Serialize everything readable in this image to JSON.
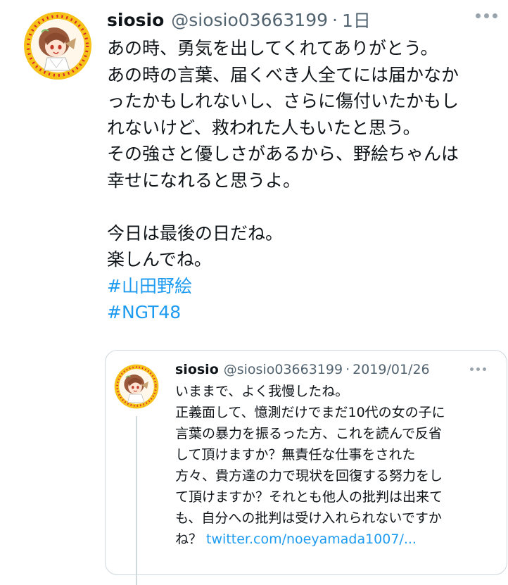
{
  "tweet": {
    "display_name": "siosio",
    "handle": "@siosio03663199",
    "separator": "·",
    "timestamp": "1日",
    "lines": [
      "あの時、勇気を出してくれてありがとう。",
      "あの時の言葉、届くべき人全てには届かなか",
      "ったかもしれないし、さらに傷付いたかもし",
      "れないけど、救われた人もいたと思う。",
      "その強さと優しさがあるから、野絵ちゃんは",
      "幸せになれると思うよ。",
      "",
      "今日は最後の日だね。",
      "楽しんでね。"
    ],
    "hashtags": [
      "#山田野絵",
      "#NGT48"
    ],
    "more_icon": "more-horizontal-icon",
    "avatar_icon": "profile-avatar"
  },
  "quoted": {
    "display_name": "siosio",
    "handle": "@siosio03663199",
    "separator": "·",
    "date": "2019/01/26",
    "lines": [
      "いままで、よく我慢したね。",
      "正義面して、憶測だけでまだ10代の女の子に",
      "言葉の暴力を振るった方、これを読んで反省",
      "して頂けますか？無責任な仕事をされた",
      "方々、貴方達の力で現状を回復する努力をし",
      "て頂けますか？それとも他人の批判は出来て",
      "も、自分への批判は受け入れられないですか"
    ],
    "last_line_prefix": "ね？ ",
    "link_text": "twitter.com/noeyamada1007/...",
    "more_icon": "more-horizontal-icon"
  },
  "colors": {
    "text": "#0f1419",
    "secondary": "#536471",
    "link": "#1d9bf0",
    "border": "#cfd9de",
    "avatar_frame": "#f6c21a",
    "avatar_dots": "#d7262b"
  }
}
